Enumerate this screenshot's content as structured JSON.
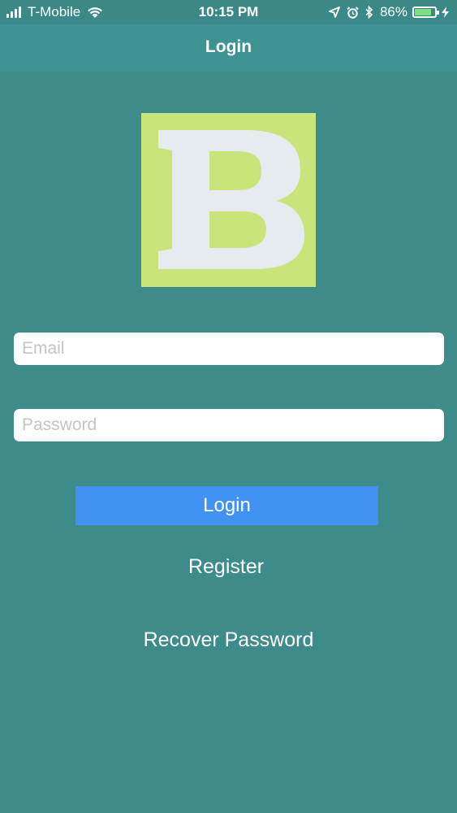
{
  "status_bar": {
    "carrier": "T-Mobile",
    "time": "10:15 PM",
    "battery_percent": "86%",
    "battery_level": 0.86,
    "icons": [
      "signal-icon",
      "wifi-icon",
      "location-icon",
      "alarm-icon",
      "bluetooth-icon",
      "battery-icon",
      "charging-icon"
    ]
  },
  "nav": {
    "title": "Login"
  },
  "logo": {
    "letter": "B",
    "background_color": "#c8e57c",
    "letter_color": "#e6ebf0"
  },
  "form": {
    "email_placeholder": "Email",
    "email_value": "",
    "password_placeholder": "Password",
    "password_value": ""
  },
  "actions": {
    "login_label": "Login",
    "register_label": "Register",
    "recover_label": "Recover Password"
  },
  "colors": {
    "background": "#3e8b8b",
    "nav_bar": "#3f9292",
    "login_button": "#4192f2"
  }
}
